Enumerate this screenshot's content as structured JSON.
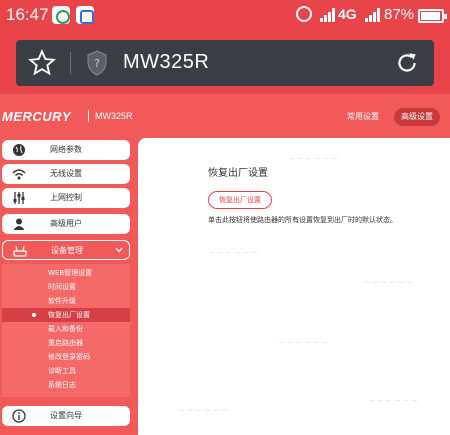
{
  "status_bar": {
    "time": "16:47",
    "network": "4G",
    "battery": "87%"
  },
  "browser": {
    "domain": "MW325R"
  },
  "header": {
    "brand": "MERCURY",
    "model": "MW325R",
    "common_settings": "常用设置",
    "advanced_settings": "高级设置"
  },
  "sidebar": {
    "items": [
      {
        "label": "网络参数",
        "icon": "globe-icon"
      },
      {
        "label": "无线设置",
        "icon": "wifi-icon"
      },
      {
        "label": "上网控制",
        "icon": "sliders-icon"
      },
      {
        "label": "高级用户",
        "icon": "user-icon"
      },
      {
        "label": "设备管理",
        "icon": "router-icon"
      }
    ],
    "submenu": [
      "WEB管理设置",
      "时间设置",
      "软件升级",
      "恢复出厂设置",
      "载入和备份",
      "重启路由器",
      "修改登录密码",
      "诊断工具",
      "系统日志"
    ],
    "wizard": "设置向导"
  },
  "content": {
    "title": "恢复出厂设置",
    "button": "恢复出厂设置",
    "description": "单击此按钮将使路由器的所有设置恢复到出厂时的默认状态。"
  },
  "colors": {
    "accent": "#f25a5a",
    "statusbar": "#e8444a",
    "url_bar": "#3b3f45"
  }
}
